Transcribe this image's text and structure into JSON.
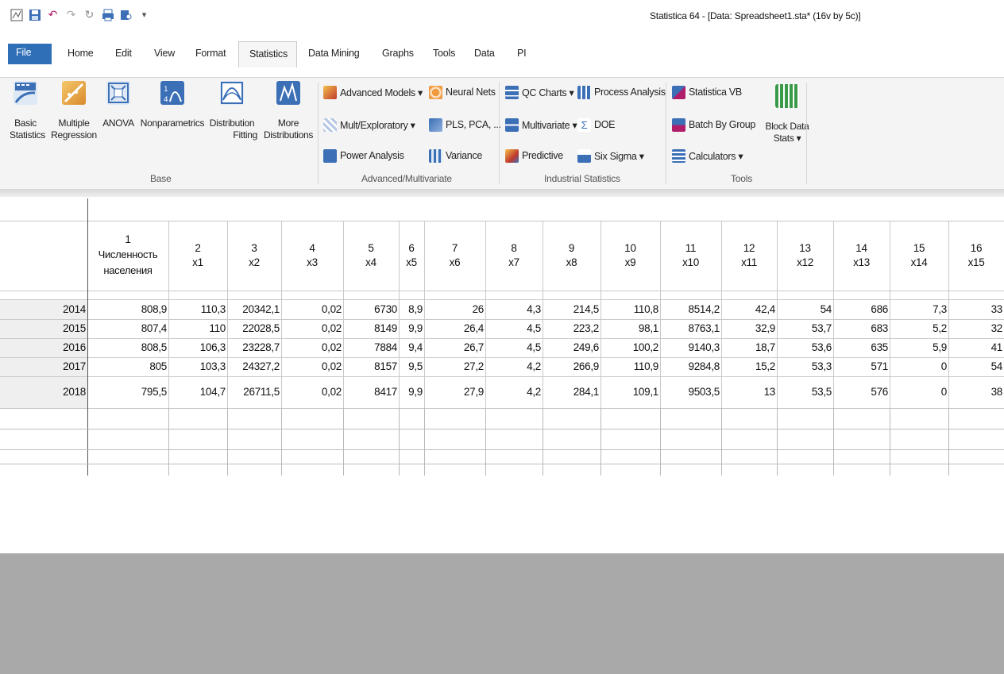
{
  "window": {
    "title": "Statistica 64 - [Data: Spreadsheet1.sta* (16v by 5c)]",
    "quick_access": [
      "app-icon",
      "save-icon",
      "undo-icon",
      "redo-icon",
      "refresh-icon",
      "print-icon",
      "preview-icon",
      "customize-dropdown-icon"
    ]
  },
  "tabs": {
    "file": "File",
    "home": "Home",
    "edit": "Edit",
    "view": "View",
    "format": "Format",
    "statistics": "Statistics",
    "data_mining": "Data Mining",
    "graphs": "Graphs",
    "tools": "Tools",
    "data": "Data",
    "pi": "PI"
  },
  "ribbon": {
    "base": {
      "label": "Base",
      "basic_stats": [
        "Basic",
        "Statistics"
      ],
      "multiple_regression": [
        "Multiple",
        "Regression"
      ],
      "anova": [
        "ANOVA"
      ],
      "nonparametrics": [
        "Nonparametrics"
      ],
      "distribution_fitting": [
        "Distribution",
        "Fitting"
      ],
      "more_distributions": [
        "More",
        "Distributions"
      ]
    },
    "advanced": {
      "label": "Advanced/Multivariate",
      "advanced_models": "Advanced Models ▾",
      "neural_nets": "Neural Nets",
      "mult_exploratory": "Mult/Exploratory ▾",
      "pls_pca": "PLS, PCA, ...",
      "power_analysis": "Power Analysis",
      "variance": "Variance"
    },
    "industrial": {
      "label": "Industrial Statistics",
      "qc_charts": "QC Charts ▾",
      "process_analysis": "Process Analysis",
      "multivariate": "Multivariate ▾",
      "doe": "DOE",
      "predictive": "Predictive",
      "six_sigma": "Six Sigma ▾"
    },
    "tools": {
      "label": "Tools",
      "statistica_vb": "Statistica VB",
      "batch_by_group": "Batch By Group",
      "calculators": "Calculators ▾",
      "block_data_stats": [
        "Block Data",
        "Stats ▾"
      ]
    }
  },
  "spreadsheet": {
    "columns": [
      {
        "num": "1",
        "name": "Численность населения"
      },
      {
        "num": "2",
        "name": "x1"
      },
      {
        "num": "3",
        "name": "x2"
      },
      {
        "num": "4",
        "name": "x3"
      },
      {
        "num": "5",
        "name": "x4"
      },
      {
        "num": "6",
        "name": "x5"
      },
      {
        "num": "7",
        "name": "x6"
      },
      {
        "num": "8",
        "name": "x7"
      },
      {
        "num": "9",
        "name": "x8"
      },
      {
        "num": "10",
        "name": "x9"
      },
      {
        "num": "11",
        "name": "x10"
      },
      {
        "num": "12",
        "name": "x11"
      },
      {
        "num": "13",
        "name": "x12"
      },
      {
        "num": "14",
        "name": "x13"
      },
      {
        "num": "15",
        "name": "x14"
      },
      {
        "num": "16",
        "name": "x15"
      }
    ],
    "rows": [
      {
        "label": "2014",
        "values": [
          "808,9",
          "110,3",
          "20342,1",
          "0,02",
          "6730",
          "8,9",
          "26",
          "4,3",
          "214,5",
          "110,8",
          "8514,2",
          "42,4",
          "54",
          "686",
          "7,3",
          "33"
        ]
      },
      {
        "label": "2015",
        "values": [
          "807,4",
          "110",
          "22028,5",
          "0,02",
          "8149",
          "9,9",
          "26,4",
          "4,5",
          "223,2",
          "98,1",
          "8763,1",
          "32,9",
          "53,7",
          "683",
          "5,2",
          "32"
        ]
      },
      {
        "label": "2016",
        "values": [
          "808,5",
          "106,3",
          "23228,7",
          "0,02",
          "7884",
          "9,4",
          "26,7",
          "4,5",
          "249,6",
          "100,2",
          "9140,3",
          "18,7",
          "53,6",
          "635",
          "5,9",
          "41"
        ]
      },
      {
        "label": "2017",
        "values": [
          "805",
          "103,3",
          "24327,2",
          "0,02",
          "8157",
          "9,5",
          "27,2",
          "4,2",
          "266,9",
          "110,9",
          "9284,8",
          "15,2",
          "53,3",
          "571",
          "0",
          "54"
        ]
      },
      {
        "label": "2018",
        "values": [
          "795,5",
          "104,7",
          "26711,5",
          "0,02",
          "8417",
          "9,9",
          "27,9",
          "4,2",
          "284,1",
          "109,1",
          "9503,5",
          "13",
          "53,5",
          "576",
          "0",
          "38"
        ]
      }
    ]
  }
}
